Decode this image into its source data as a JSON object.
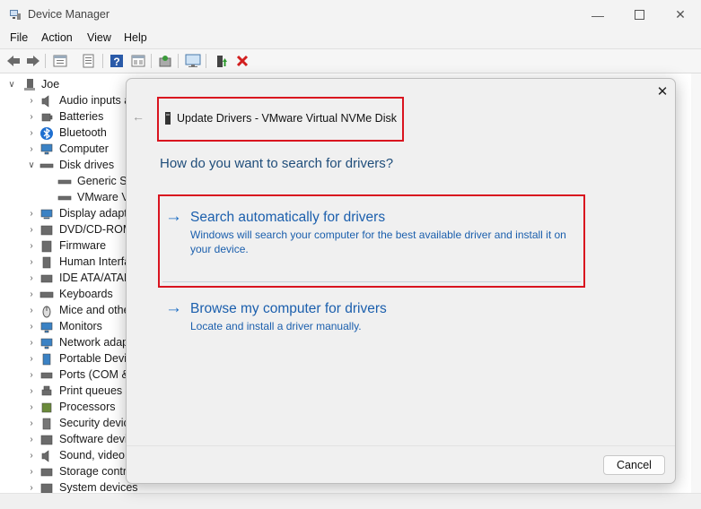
{
  "window": {
    "title": "Device Manager",
    "app_icon": "device-manager-icon",
    "controls": [
      "minimize",
      "maximize",
      "close"
    ]
  },
  "menu": [
    "File",
    "Action",
    "View",
    "Help"
  ],
  "toolbar": {
    "icons": [
      "back-arrow-icon",
      "forward-arrow-icon",
      "properties-icon",
      "update-driver-icon",
      "help-icon",
      "show-hidden-icon",
      "scan-hardware-icon",
      "monitor-icon",
      "add-driver-icon",
      "uninstall-icon"
    ]
  },
  "tree": {
    "root": "Joe",
    "items": [
      {
        "label": "Audio inputs a",
        "icon": "audio-icon",
        "expanded": false
      },
      {
        "label": "Batteries",
        "icon": "battery-icon",
        "expanded": false
      },
      {
        "label": "Bluetooth",
        "icon": "bluetooth-icon",
        "expanded": false
      },
      {
        "label": "Computer",
        "icon": "computer-icon",
        "expanded": false
      },
      {
        "label": "Disk drives",
        "icon": "disk-icon",
        "expanded": true
      },
      {
        "label": "Generic ST",
        "icon": "disk-icon",
        "child": true
      },
      {
        "label": "VMware Vi",
        "icon": "disk-icon",
        "child": true
      },
      {
        "label": "Display adapte",
        "icon": "display-icon",
        "expanded": false
      },
      {
        "label": "DVD/CD-ROM",
        "icon": "dvd-icon",
        "expanded": false
      },
      {
        "label": "Firmware",
        "icon": "firmware-icon",
        "expanded": false
      },
      {
        "label": "Human Interfa",
        "icon": "hid-icon",
        "expanded": false
      },
      {
        "label": "IDE ATA/ATAPI",
        "icon": "ide-icon",
        "expanded": false
      },
      {
        "label": "Keyboards",
        "icon": "keyboard-icon",
        "expanded": false
      },
      {
        "label": "Mice and othe",
        "icon": "mouse-icon",
        "expanded": false
      },
      {
        "label": "Monitors",
        "icon": "monitor-icon",
        "expanded": false
      },
      {
        "label": "Network adap",
        "icon": "network-icon",
        "expanded": false
      },
      {
        "label": "Portable Devic",
        "icon": "portable-icon",
        "expanded": false
      },
      {
        "label": "Ports (COM &",
        "icon": "port-icon",
        "expanded": false
      },
      {
        "label": "Print queues",
        "icon": "printer-icon",
        "expanded": false
      },
      {
        "label": "Processors",
        "icon": "processor-icon",
        "expanded": false
      },
      {
        "label": "Security devic",
        "icon": "security-icon",
        "expanded": false
      },
      {
        "label": "Software devic",
        "icon": "software-icon",
        "expanded": false
      },
      {
        "label": "Sound, video a",
        "icon": "sound-icon",
        "expanded": false
      },
      {
        "label": "Storage contro",
        "icon": "storage-icon",
        "expanded": false
      },
      {
        "label": "System devices",
        "icon": "system-icon",
        "expanded": false
      }
    ]
  },
  "dialog": {
    "title": "Update Drivers - VMware Virtual NVMe Disk",
    "question": "How do you want to search for drivers?",
    "option1": {
      "title": "Search automatically for drivers",
      "desc": "Windows will search your computer for the best available driver and install it on your device."
    },
    "option2": {
      "title": "Browse my computer for drivers",
      "desc": "Locate and install a driver manually."
    },
    "cancel": "Cancel",
    "close_glyph": "✕",
    "back_glyph": "←"
  },
  "colors": {
    "highlight": "#d9141f",
    "link": "#1b5fad",
    "heading": "#1f4d7a"
  }
}
